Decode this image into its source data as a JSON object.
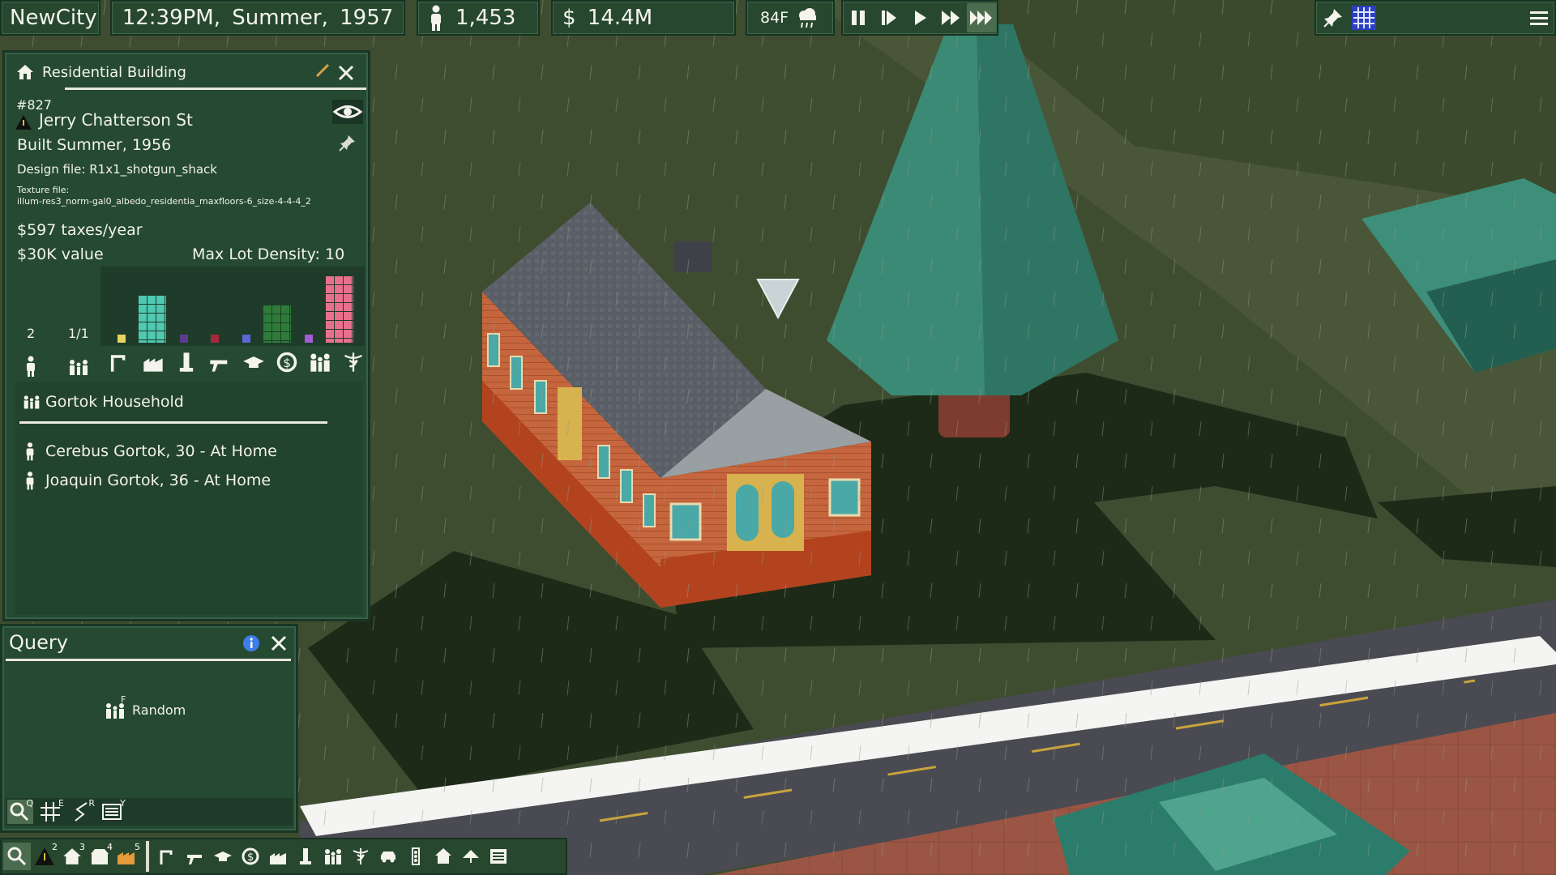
{
  "topbar": {
    "city": "NewCity",
    "time": "12:39PM, Summer, 1957",
    "population": "1,453",
    "money": "$ 14.4M",
    "temperature": "84F",
    "weather_icon": "rain-cloud-icon",
    "speed_buttons": [
      "pause",
      "step",
      "play",
      "fast",
      "fastest"
    ],
    "speed_active": "fastest"
  },
  "building_panel": {
    "title": "Residential Building",
    "id": "#827",
    "street": "Jerry Chatterson St",
    "built": "Built Summer, 1956",
    "design_file": "Design file: R1x1_shotgun_shack",
    "texture_label": "Texture file:",
    "texture_file": "illum-res3_norm-gal0_albedo_residentia_maxfloors-6_size-4-4-4_2",
    "taxes": "$597 taxes/year",
    "value": "$30K value",
    "density": "Max Lot Density: 10",
    "residents": "2",
    "households": "1/1",
    "demand_icons": [
      "road-icon",
      "factory-icon",
      "office-icon",
      "gun-icon",
      "education-icon",
      "money-icon",
      "family-icon",
      "medical-icon"
    ],
    "demand_levels": [
      {
        "label": "yellow",
        "color": "#e8d45c",
        "level": 1
      },
      {
        "label": "teal",
        "color": "#4fc9b1",
        "level": 5
      },
      {
        "label": "purple",
        "color": "#5a3c8c",
        "level": 1
      },
      {
        "label": "red",
        "color": "#a8283a",
        "level": 1
      },
      {
        "label": "blue",
        "color": "#5c68d8",
        "level": 1
      },
      {
        "label": "green",
        "color": "#2f7c3a",
        "level": 4
      },
      {
        "label": "violet",
        "color": "#a55bd6",
        "level": 1
      },
      {
        "label": "pink",
        "color": "#e8708c",
        "level": 7
      }
    ]
  },
  "household": {
    "name": "Gortok Household",
    "members": [
      "Cerebus Gortok, 30 - At Home",
      "Joaquin Gortok, 36 - At Home"
    ]
  },
  "query_panel": {
    "title": "Query",
    "random_label": "Random",
    "random_key": "F",
    "tool_keys": [
      "Q",
      "E",
      "R",
      "Y"
    ]
  },
  "bottom_bar": {
    "keys": [
      "",
      "2",
      "3",
      "4",
      "5"
    ]
  },
  "colors": {
    "panel_bg": "#254a31",
    "panel_border": "#1a3524",
    "grass": "#3e4d30",
    "road": "#4a4a52"
  }
}
